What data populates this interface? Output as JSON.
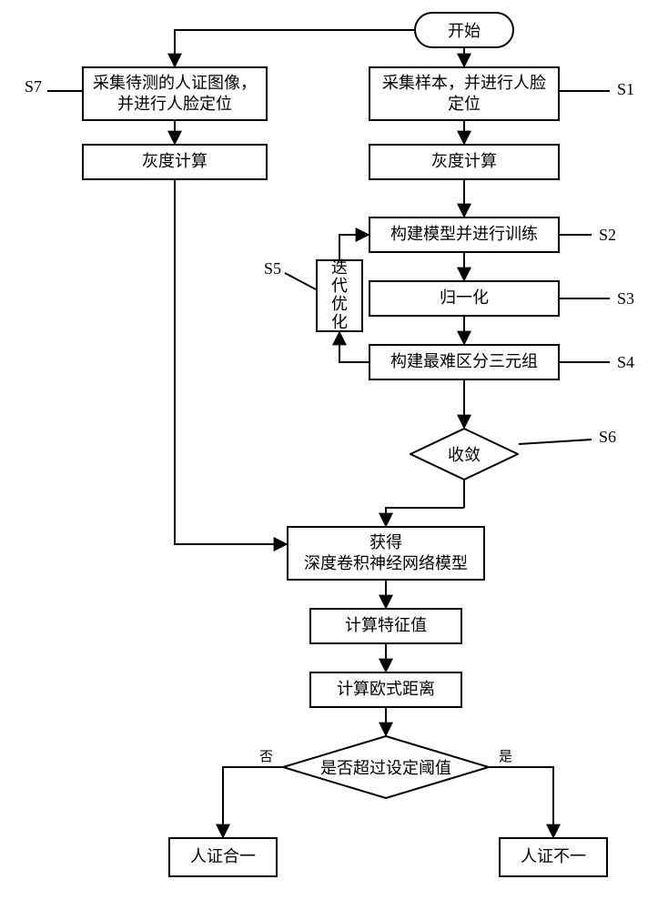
{
  "chart_data": {
    "type": "flowchart",
    "title": "",
    "nodes": [
      {
        "id": "start",
        "type": "terminator",
        "label": "开始"
      },
      {
        "id": "s1",
        "type": "process",
        "label": "采集样本，并进行人脸定位",
        "tag": "S1"
      },
      {
        "id": "gray_r",
        "type": "process",
        "label": "灰度计算"
      },
      {
        "id": "s2",
        "type": "process",
        "label": "构建模型并进行训练",
        "tag": "S2"
      },
      {
        "id": "s3",
        "type": "process",
        "label": "归一化",
        "tag": "S3"
      },
      {
        "id": "s4",
        "type": "process",
        "label": "构建最难区分三元组",
        "tag": "S4"
      },
      {
        "id": "s5",
        "type": "process",
        "label": "迭代优化",
        "tag": "S5"
      },
      {
        "id": "s6",
        "type": "decision",
        "label": "收敛",
        "tag": "S6"
      },
      {
        "id": "obtain",
        "type": "process",
        "label": "获得深度卷积神经网络模型"
      },
      {
        "id": "calc_feat",
        "type": "process",
        "label": "计算特征值"
      },
      {
        "id": "calc_euclid",
        "type": "process",
        "label": "计算欧式距离"
      },
      {
        "id": "threshold",
        "type": "decision",
        "label": "是否超过设定阈值"
      },
      {
        "id": "match",
        "type": "process",
        "label": "人证合一",
        "branch": "否"
      },
      {
        "id": "nomatch",
        "type": "process",
        "label": "人证不一",
        "branch": "是"
      },
      {
        "id": "s7",
        "type": "process",
        "label": "采集待测的人证图像，并进行人脸定位",
        "tag": "S7"
      },
      {
        "id": "gray_l",
        "type": "process",
        "label": "灰度计算"
      }
    ],
    "edges": [
      [
        "start",
        "s1"
      ],
      [
        "start",
        "s7"
      ],
      [
        "s1",
        "gray_r"
      ],
      [
        "gray_r",
        "s2"
      ],
      [
        "s2",
        "s3"
      ],
      [
        "s3",
        "s4"
      ],
      [
        "s4",
        "s5"
      ],
      [
        "s5",
        "s2"
      ],
      [
        "s4",
        "s6_via"
      ],
      [
        "s6",
        "obtain"
      ],
      [
        "obtain",
        "calc_feat"
      ],
      [
        "calc_feat",
        "calc_euclid"
      ],
      [
        "calc_euclid",
        "threshold"
      ],
      [
        "threshold",
        "match",
        "否"
      ],
      [
        "threshold",
        "nomatch",
        "是"
      ],
      [
        "s7",
        "gray_l"
      ],
      [
        "gray_l",
        "obtain"
      ]
    ]
  },
  "start": "开始",
  "s7": {
    "text": "采集待测的人证图像，并进行人脸定位",
    "label": "S7"
  },
  "gray_l": "灰度计算",
  "s1": {
    "text": "采集样本，并进行人脸定位",
    "label": "S1"
  },
  "gray_r": "灰度计算",
  "s2": {
    "text": "构建模型并进行训练",
    "label": "S2"
  },
  "s3": {
    "text": "归一化",
    "label": "S3"
  },
  "s4": {
    "text": "构建最难区分三元组",
    "label": "S4"
  },
  "s5": {
    "text": "迭代优化",
    "label": "S5"
  },
  "s6": {
    "text": "收敛",
    "label": "S6"
  },
  "obtain": {
    "l1": "获得",
    "l2": "深度卷积神经网络模型"
  },
  "calc_feat": "计算特征值",
  "calc_euclid": "计算欧式距离",
  "threshold": "是否超过设定阈值",
  "branch_no": "否",
  "branch_yes": "是",
  "result_match": "人证合一",
  "result_nomatch": "人证不一"
}
